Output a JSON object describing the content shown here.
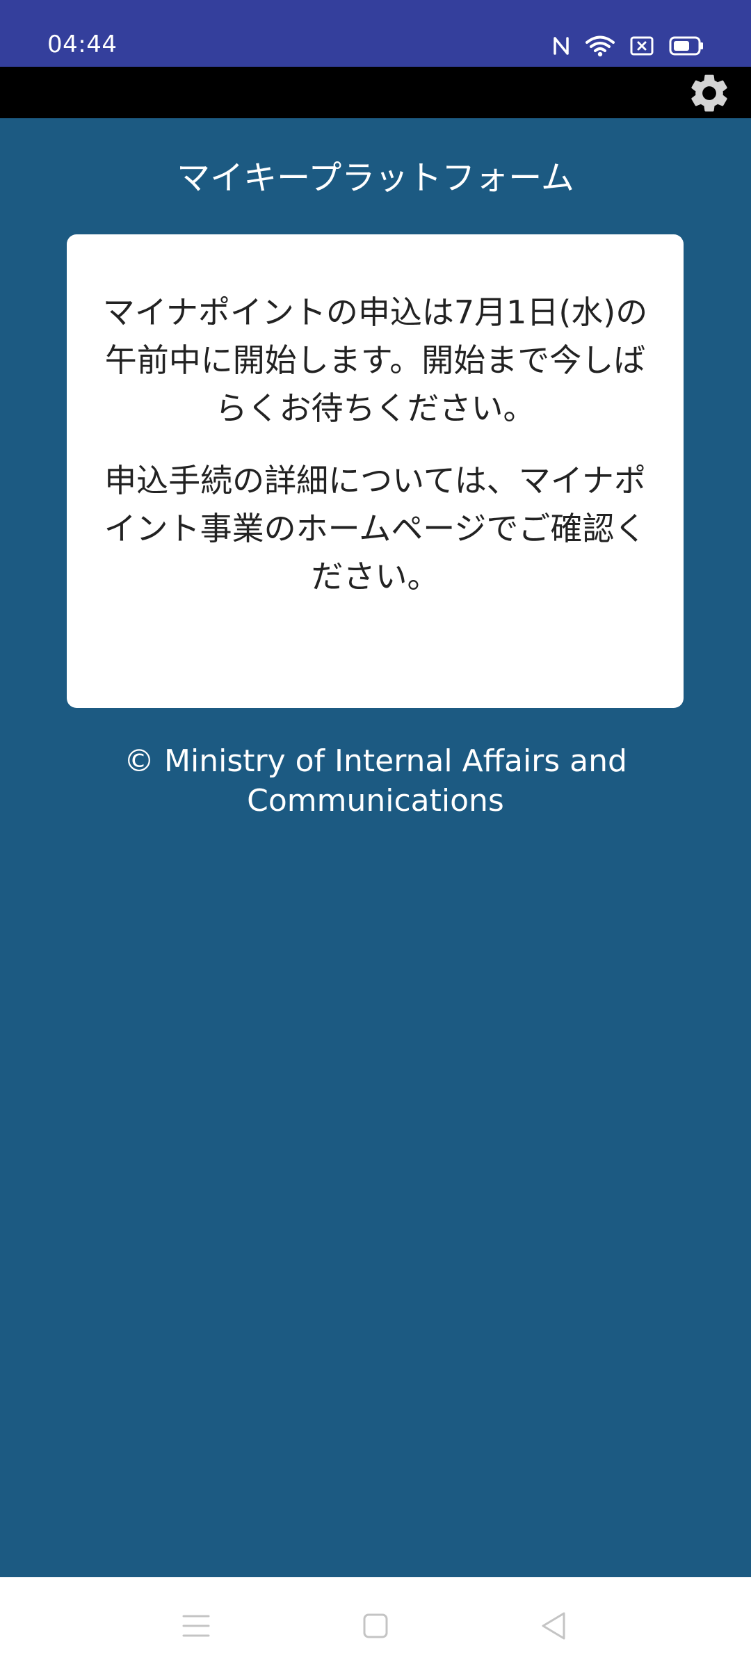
{
  "status_bar": {
    "time": "04:44",
    "icons": [
      "nfc-icon",
      "wifi-icon",
      "sim-off-icon",
      "battery-icon"
    ],
    "color": "#343f9c"
  },
  "toolbar": {
    "settings_icon": "gear-icon",
    "color": "#000000"
  },
  "main": {
    "title": "マイキープラットフォーム",
    "background": "#1c5a82",
    "notice": {
      "message_1": "マイナポイントの申込は7月1日(水)の午前中に開始します。開始まで今しばらくお待ちください。",
      "message_2": "申込手続の詳細については、マイナポイント事業のホームページでご確認ください。"
    },
    "copyright": "© Ministry of Internal Affairs and Communications"
  },
  "nav_bar": {
    "buttons": [
      "menu-icon",
      "home-icon",
      "back-icon"
    ]
  }
}
